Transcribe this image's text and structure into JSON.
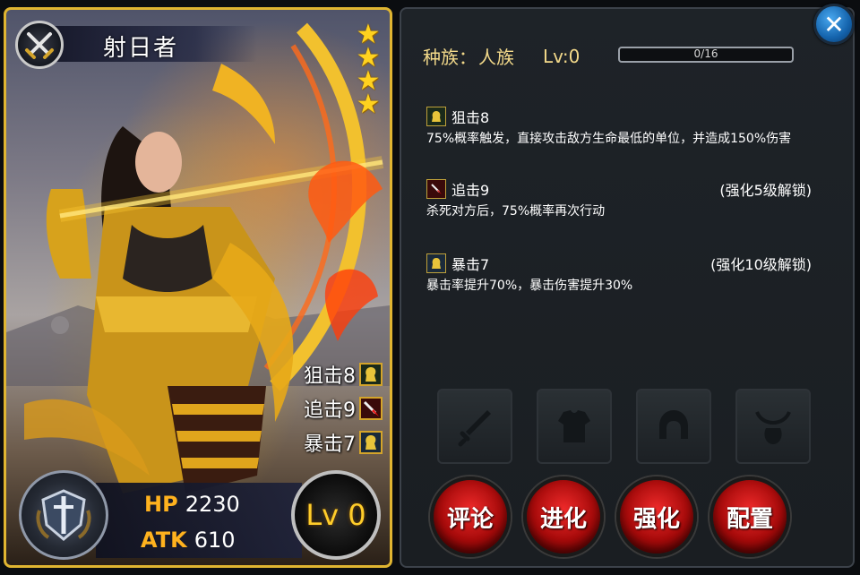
{
  "hero": {
    "name": "射日者",
    "star_count": 4,
    "stats": {
      "hp_label": "HP",
      "hp_value": "2230",
      "atk_label": "ATK",
      "atk_value": "610"
    },
    "level_badge": "Lv 0",
    "skill_tags": [
      {
        "label": "狙击8",
        "icon": "snipe-icon"
      },
      {
        "label": "追击9",
        "icon": "pursuit-icon"
      },
      {
        "label": "暴击7",
        "icon": "critical-icon"
      }
    ]
  },
  "info": {
    "race_label": "种族：",
    "race_value": "人族",
    "level_label": "Lv:0",
    "xp_text": "0/16",
    "xp_progress": 0
  },
  "skills": [
    {
      "name": "狙击8",
      "unlock": "",
      "desc": "75%概率触发，直接攻击敌方生命最低的单位，并造成150%伤害"
    },
    {
      "name": "追击9",
      "unlock": "(强化5级解锁)",
      "desc": "杀死对方后，75%概率再次行动"
    },
    {
      "name": "暴击7",
      "unlock": "(强化10级解锁)",
      "desc": "暴击率提升70%，暴击伤害提升30%"
    }
  ],
  "equipment_slots": [
    "sword-slot-icon",
    "armor-slot-icon",
    "helmet-slot-icon",
    "accessory-slot-icon"
  ],
  "buttons": {
    "comment": "评论",
    "evolve": "进化",
    "enhance": "强化",
    "configure": "配置"
  },
  "close_label": "✕",
  "colors": {
    "gold": "#e0b531",
    "accent_red": "#c41414",
    "close_blue": "#1f7acb",
    "race_text": "#f3d98a"
  }
}
